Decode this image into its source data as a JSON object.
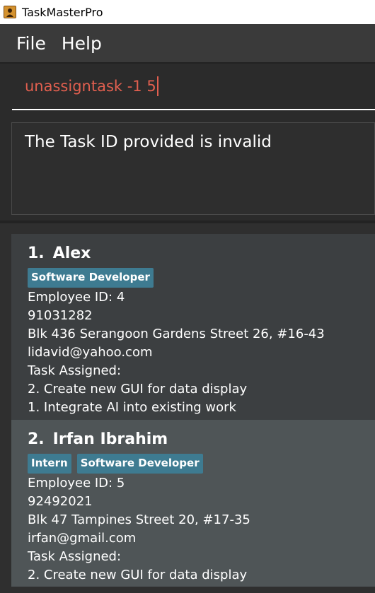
{
  "window": {
    "title": "TaskMasterPro"
  },
  "menu": {
    "file": "File",
    "help": "Help"
  },
  "command": {
    "value": "unassigntask -1 5"
  },
  "result": {
    "message": "The Task ID provided is invalid"
  },
  "employees": [
    {
      "index": "1.",
      "name": "Alex",
      "tags": [
        "Software Developer"
      ],
      "employee_id": "Employee ID: 4",
      "phone": "91031282",
      "address": "Blk 436 Serangoon Gardens Street 26, #16-43",
      "email": "lidavid@yahoo.com",
      "tasks_label": "Task Assigned:",
      "tasks": [
        "2. Create new GUI for data display",
        "1. Integrate AI into existing work"
      ]
    },
    {
      "index": "2.",
      "name": "Irfan Ibrahim",
      "tags": [
        "Intern",
        "Software Developer"
      ],
      "employee_id": "Employee ID: 5",
      "phone": "92492021",
      "address": "Blk 47 Tampines Street 20, #17-35",
      "email": "irfan@gmail.com",
      "tasks_label": "Task Assigned:",
      "tasks": [
        "2. Create new GUI for data display"
      ]
    }
  ],
  "colors": {
    "tag_bg": "#3e7b91",
    "command_text": "#e15f4f",
    "card_bg": "#3c3f41",
    "card_selected_bg": "#4f5557"
  }
}
